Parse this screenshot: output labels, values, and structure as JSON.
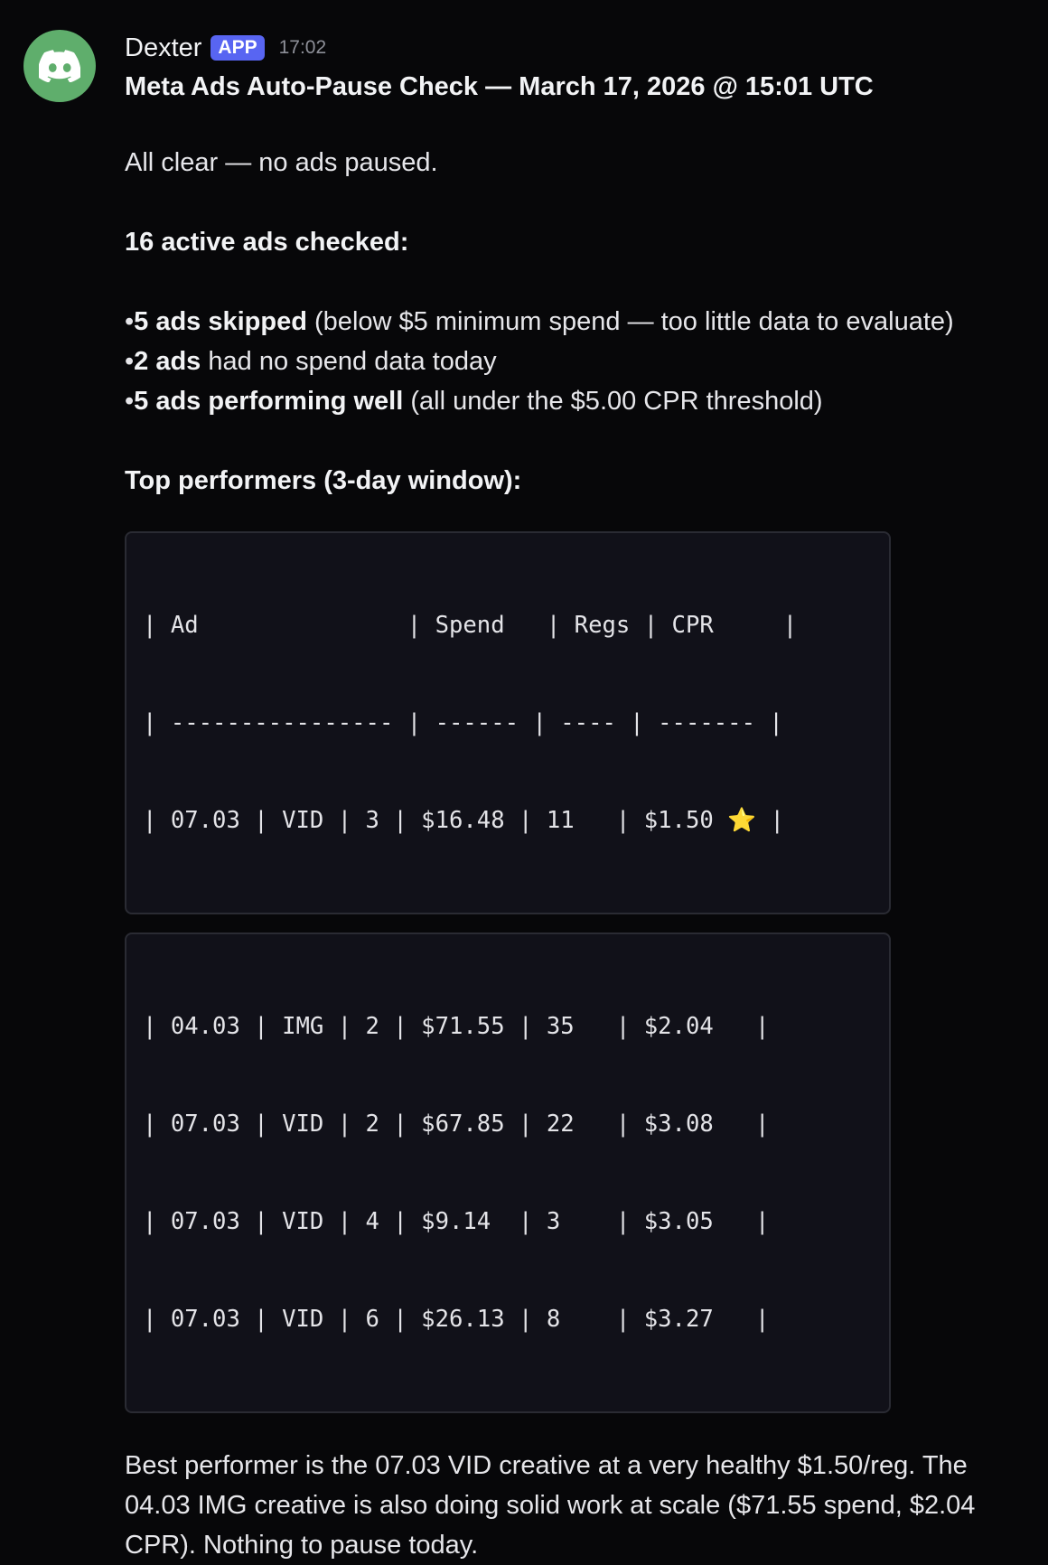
{
  "message": {
    "username": "Dexter",
    "badge": "APP",
    "timestamp": "17:02",
    "title": "Meta Ads Auto-Pause Check — March 17, 2026 @ 15:01 UTC",
    "status_line": "All clear — no ads paused.",
    "checked_heading": "16 active ads checked:",
    "bullets": [
      {
        "marker": "•",
        "bold": "5 ads skipped",
        "rest": " (below $5 minimum spend — too little data to evaluate)"
      },
      {
        "marker": "•",
        "bold": "2 ads",
        "rest": " had no spend data today"
      },
      {
        "marker": "•",
        "bold": "5 ads performing well",
        "rest": " (all under the $5.00 CPR threshold)"
      }
    ],
    "top_heading": "Top performers (3-day window):",
    "table1": [
      "| Ad               | Spend   | Regs | CPR     |",
      "| ---------------- | ------ | ---- | ------- |",
      "| 07.03 | VID | 3 | $16.48 | 11   | $1.50 ⭐ |"
    ],
    "table2": [
      "| 04.03 | IMG | 2 | $71.55 | 35   | $2.04   |",
      "| 07.03 | VID | 2 | $67.85 | 22   | $3.08   |",
      "| 07.03 | VID | 4 | $9.14  | 3    | $3.05   |",
      "| 07.03 | VID | 6 | $26.13 | 8    | $3.27   |"
    ],
    "summary": "Best performer is the 07.03 VID creative at a very healthy $1.50/reg. The 04.03 IMG creative is also doing solid work at scale ($71.55 spend, $2.04 CPR). Nothing to pause today."
  },
  "colors": {
    "background": "#070709",
    "avatar": "#5fae6c",
    "badge": "#5865f2",
    "codeblock_bg": "#111119"
  },
  "icons": {
    "avatar": "discord-logo-icon"
  }
}
